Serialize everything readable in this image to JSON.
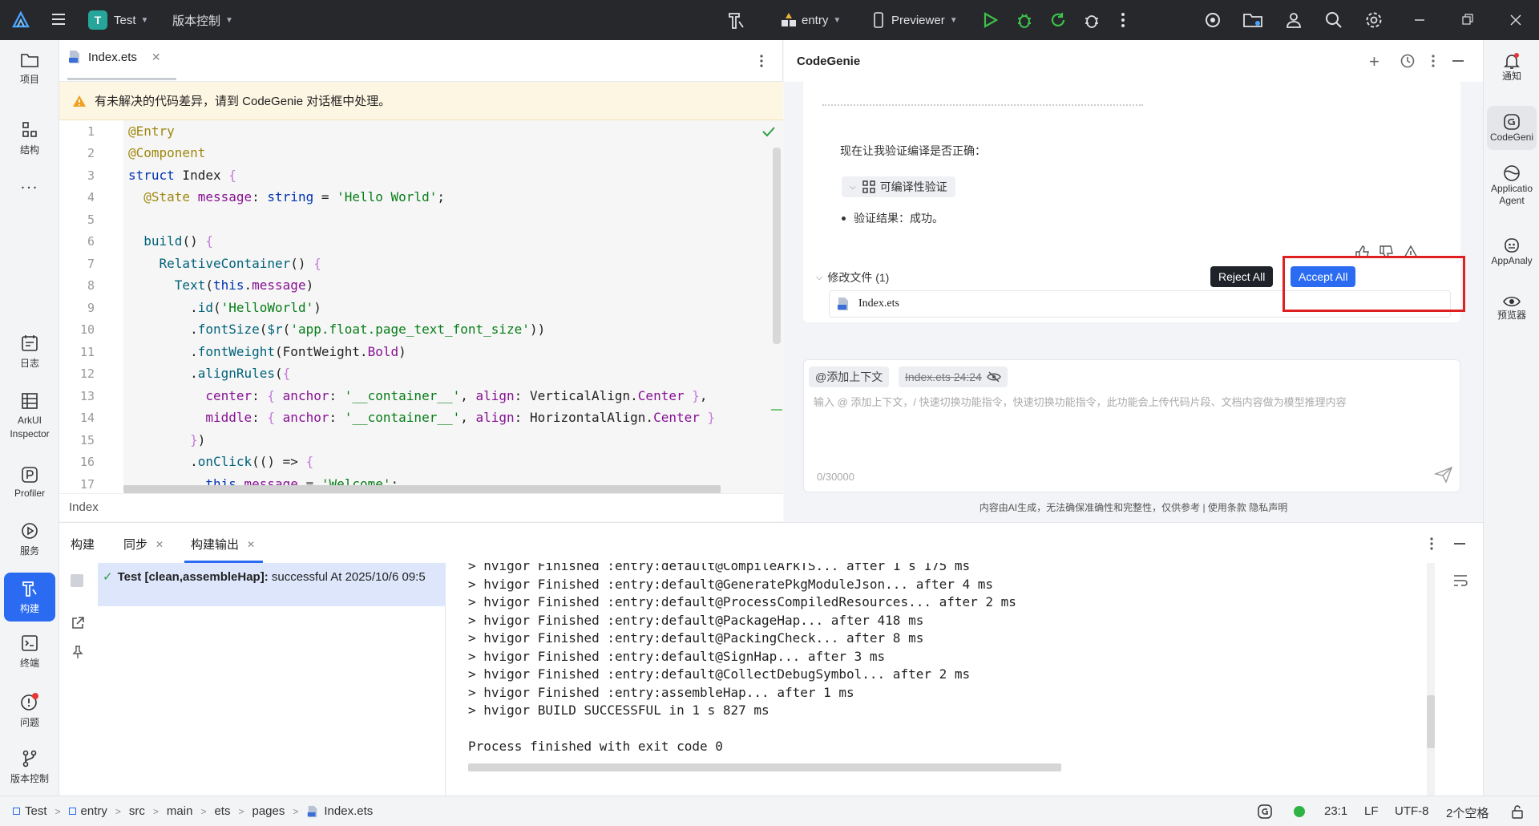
{
  "titlebar": {
    "project_badge": "T",
    "project_name": "Test",
    "vcs_menu": "版本控制",
    "run_config": "entry",
    "previewer": "Previewer"
  },
  "left_tools": [
    {
      "label": "项目",
      "icon": "folder-icon"
    },
    {
      "label": "结构",
      "icon": "structure-icon"
    },
    {
      "label": "...",
      "icon": "more-icon"
    },
    {
      "label": "日志",
      "icon": "log-icon"
    },
    {
      "label": "ArkUI Inspector",
      "icon": "inspector-icon"
    },
    {
      "label": "Profiler",
      "icon": "profiler-icon"
    },
    {
      "label": "服务",
      "icon": "services-icon"
    },
    {
      "label": "构建",
      "icon": "build-icon"
    },
    {
      "label": "终端",
      "icon": "terminal-icon"
    },
    {
      "label": "问题",
      "icon": "problems-icon"
    },
    {
      "label": "版本控制",
      "icon": "vcs-icon"
    }
  ],
  "right_tools": [
    {
      "label": "通知",
      "icon": "bell-icon"
    },
    {
      "label": "CodeGeni",
      "icon": "codegenie-icon"
    },
    {
      "label": "Applicatio Agent",
      "icon": "agent-icon"
    },
    {
      "label": "AppAnaly",
      "icon": "appanalyzer-icon"
    },
    {
      "label": "预览器",
      "icon": "eye-icon"
    }
  ],
  "editor": {
    "tab_label": "Index.ets",
    "warning": "有未解决的代码差异，请到 CodeGenie 对话框中处理。",
    "footer": "Index",
    "line_numbers": [
      "1",
      "2",
      "3",
      "4",
      "5",
      "6",
      "7",
      "8",
      "9",
      "10",
      "11",
      "12",
      "13",
      "14",
      "15",
      "16",
      "17"
    ]
  },
  "genie": {
    "title": "CodeGenie",
    "verify_text": "现在让我验证编译是否正确：",
    "compile_check_label": "可编译性验证",
    "result_text": "验证结果：成功。",
    "modified_files_label": "修改文件 (1)",
    "reject_label": "Reject All",
    "accept_label": "Accept All",
    "file_name": "Index.ets",
    "add_context_chip": "@添加上下文",
    "file_chip": "Index.ets 24:24",
    "input_placeholder": "输入 @ 添加上下文，/ 快速切换功能指令，快速切换功能指令，此功能会上传代码片段、文档内容做为模型推理内容",
    "char_count": "0/30000",
    "disclaimer": "内容由AI生成，无法确保准确性和完整性，仅供参考 |  使用条款  隐私声明"
  },
  "build": {
    "tabs": [
      "构建",
      "同步",
      "构建输出"
    ],
    "tree_task": "Test [clean,assembleHap]:",
    "tree_status": " successful At 2025/10/6 09:5",
    "console_lines": [
      "> hvigor Finished :entry:default@CompileArkTS... after 1 s 175 ms",
      "> hvigor Finished :entry:default@GeneratePkgModuleJson... after 4 ms",
      "> hvigor Finished :entry:default@ProcessCompiledResources... after 2 ms",
      "> hvigor Finished :entry:default@PackageHap... after 418 ms",
      "> hvigor Finished :entry:default@PackingCheck... after 8 ms",
      "> hvigor Finished :entry:default@SignHap... after 3 ms",
      "> hvigor Finished :entry:default@CollectDebugSymbol... after 2 ms",
      "> hvigor Finished :entry:assembleHap... after 1 ms",
      "> hvigor BUILD SUCCESSFUL in 1 s 827 ms"
    ],
    "exit_line": "Process finished with exit code 0"
  },
  "statusbar": {
    "breadcrumb": [
      "Test",
      "entry",
      "src",
      "main",
      "ets",
      "pages",
      "Index.ets"
    ],
    "position": "23:1",
    "line_sep": "LF",
    "encoding": "UTF-8",
    "indent": "2个空格"
  }
}
